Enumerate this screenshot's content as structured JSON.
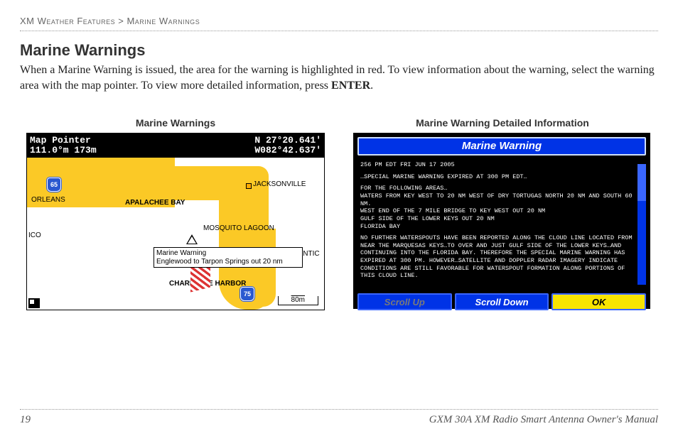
{
  "breadcrumb": {
    "section": "XM Weather Features",
    "sep": ">",
    "page": "Marine Warnings"
  },
  "title": "Marine Warnings",
  "body_text": "When a Marine Warning is issued, the area for the warning is highlighted in red. To view information about the warning, select the warning area with the map pointer. To view more detailed information, press ",
  "body_bold": "ENTER",
  "body_tail": ".",
  "figures": {
    "left_caption": "Marine Warnings",
    "right_caption": "Marine Warning Detailed Information"
  },
  "map": {
    "pointer_label": "Map Pointer",
    "bearing": "111.0°m",
    "distance": "173m",
    "lat": "N  27°20.641'",
    "lon": "W082°42.637'",
    "labels": {
      "orleans": "ORLEANS",
      "ico": "ICO",
      "apalachee": "APALACHEE BAY",
      "jacksonville": "JACKSONVILLE",
      "mosquito": "MOSQUITO LAGOON",
      "atlantic": "ATLANTIC O",
      "charlotte": "CHARLOTTE HARBOR"
    },
    "shields": {
      "i65": "65",
      "i75": "75"
    },
    "popup_title": "Marine Warning",
    "popup_text": "Englewood to Tarpon Springs out 20 nm",
    "scale": "80m"
  },
  "detail": {
    "title": "Marine Warning",
    "timestamp": "256 PM EDT FRI JUN 17 2005",
    "p1": "…SPECIAL MARINE WARNING EXPIRED AT 300 PM EDT…",
    "p2": "FOR THE FOLLOWING AREAS…\nWATERS FROM KEY WEST TO 20 NM WEST OF DRY TORTUGAS NORTH 20 NM AND SOUTH 60 NM.\nWEST END OF THE 7 MILE BRIDGE TO KEY WEST OUT 20 NM\nGULF SIDE OF THE LOWER KEYS OUT 20 NM\nFLORIDA BAY",
    "p3": "NO FURTHER WATERSPOUTS HAVE BEEN REPORTED ALONG THE CLOUD LINE LOCATED FROM NEAR THE MARQUESAS KEYS…TO OVER AND JUST GULF SIDE OF THE LOWER KEYS…AND CONTINUING INTO THE FLORIDA BAY. THEREFORE THE SPECIAL MARINE WARNING HAS EXPIRED AT 300 PM. HOWEVER…SATELLITE AND DOPPLER RADAR IMAGERY INDICATE CONDITIONS ARE STILL FAVORABLE FOR WATERSPOUT FORMATION ALONG PORTIONS OF THIS CLOUD LINE.",
    "buttons": {
      "scroll_up": "Scroll Up",
      "scroll_down": "Scroll Down",
      "ok": "OK"
    }
  },
  "footer": {
    "page_number": "19",
    "manual": "GXM 30A XM Radio Smart Antenna Owner's Manual"
  }
}
